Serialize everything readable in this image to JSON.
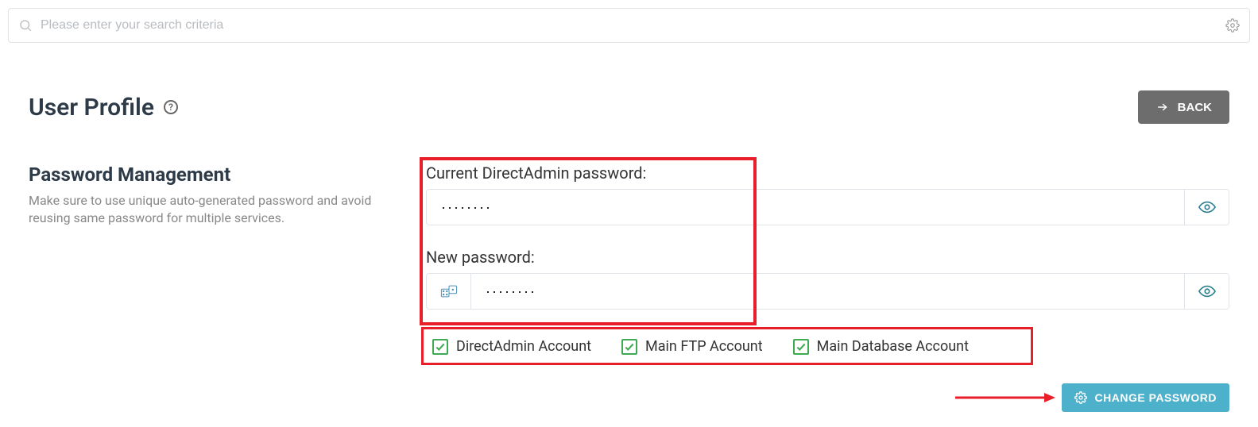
{
  "search": {
    "placeholder": "Please enter your search criteria"
  },
  "header": {
    "title": "User Profile",
    "back_label": "BACK"
  },
  "section": {
    "title": "Password Management",
    "desc": "Make sure to use unique auto-generated password and avoid reusing same password for multiple services."
  },
  "fields": {
    "current_label": "Current DirectAdmin password:",
    "current_value": "········",
    "new_label": "New password:",
    "new_value": "········"
  },
  "checkboxes": {
    "da": "DirectAdmin Account",
    "ftp": "Main FTP Account",
    "db": "Main Database Account"
  },
  "action": {
    "change_label": "CHANGE PASSWORD"
  }
}
